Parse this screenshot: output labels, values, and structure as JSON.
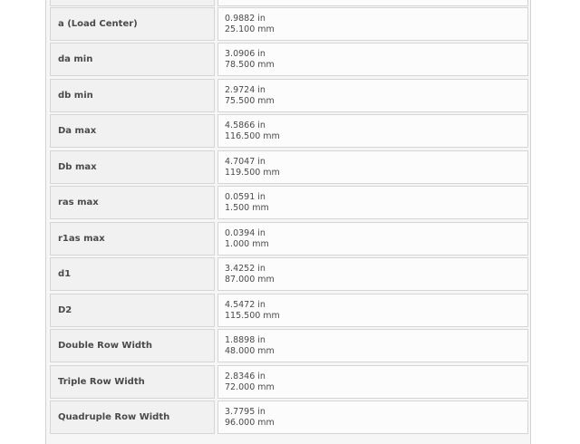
{
  "spec_rows": [
    {
      "label": "",
      "in": "",
      "mm": ""
    },
    {
      "label": "a (Load Center)",
      "in": "0.9882 in",
      "mm": "25.100 mm"
    },
    {
      "label": "da min",
      "in": "3.0906 in",
      "mm": "78.500 mm"
    },
    {
      "label": "db min",
      "in": "2.9724 in",
      "mm": "75.500 mm"
    },
    {
      "label": "Da max",
      "in": "4.5866 in",
      "mm": "116.500 mm"
    },
    {
      "label": "Db max",
      "in": "4.7047 in",
      "mm": "119.500 mm"
    },
    {
      "label": "ras max",
      "in": "0.0591 in",
      "mm": "1.500 mm"
    },
    {
      "label": "r1as max",
      "in": "0.0394 in",
      "mm": "1.000 mm"
    },
    {
      "label": "d1",
      "in": "3.4252 in",
      "mm": "87.000 mm"
    },
    {
      "label": "D2",
      "in": "4.5472 in",
      "mm": "115.500 mm"
    },
    {
      "label": "Double Row Width",
      "in": "1.8898 in",
      "mm": "48.000 mm"
    },
    {
      "label": "Triple Row Width",
      "in": "2.8346 in",
      "mm": "72.000 mm"
    },
    {
      "label": "Quadruple Row Width",
      "in": "3.7795 in",
      "mm": "96.000 mm"
    }
  ]
}
